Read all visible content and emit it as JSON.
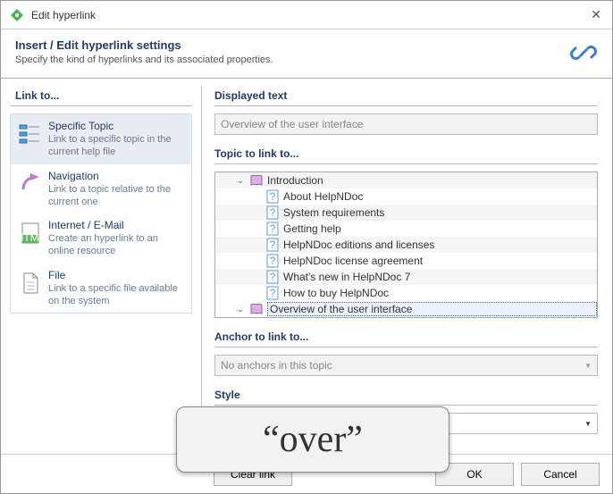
{
  "titlebar": {
    "title": "Edit hyperlink"
  },
  "header": {
    "title": "Insert / Edit hyperlink settings",
    "subtitle": "Specify the kind of hyperlinks and its associated properties."
  },
  "side": {
    "heading": "Link to...",
    "items": [
      {
        "title": "Specific Topic",
        "desc": "Link to a specific topic in the current help file"
      },
      {
        "title": "Navigation",
        "desc": "Link to a topic relative to the current one"
      },
      {
        "title": "Internet / E-Mail",
        "desc": "Create an hyperlink to an online resource"
      },
      {
        "title": "File",
        "desc": "Link to a specific file available on the system"
      }
    ]
  },
  "content": {
    "displayed_text_label": "Displayed text",
    "displayed_text_value": "Overview of the user interface",
    "topic_label": "Topic to link to...",
    "tree": {
      "root": "Introduction",
      "children": [
        "About HelpNDoc",
        "System requirements",
        "Getting help",
        "HelpNDoc editions and licenses",
        "HelpNDoc license agreement",
        "What's new in HelpNDoc 7",
        "How to buy HelpNDoc"
      ],
      "selected": "Overview of the user interface"
    },
    "anchor_label": "Anchor to link to...",
    "anchor_value": "No anchors in this topic",
    "style_label": "Style"
  },
  "footer": {
    "clear": "Clear link",
    "ok": "OK",
    "cancel": "Cancel"
  },
  "overlay": "“over”"
}
